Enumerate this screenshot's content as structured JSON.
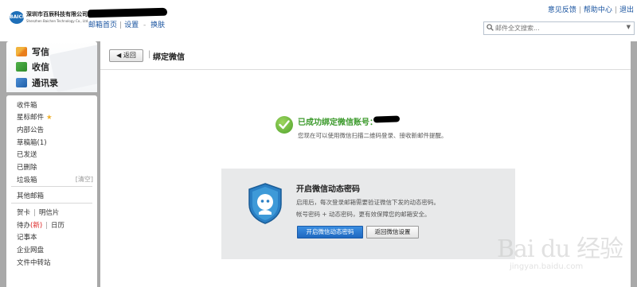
{
  "header": {
    "logo_mark": "BAICHEN",
    "company_cn": "深圳市百辰科技有限公司",
    "company_en": "Shenzhen Baichen Technology Co., Ltd.",
    "nav": [
      "邮箱首页",
      "设置",
      "换肤"
    ],
    "top_links": [
      "意见反馈",
      "帮助中心",
      "退出"
    ],
    "search_placeholder": "邮件全文搜索..."
  },
  "sidebar": {
    "actions": [
      {
        "label": "写信",
        "icon": "pencil-icon"
      },
      {
        "label": "收信",
        "icon": "inbox-icon"
      },
      {
        "label": "通讯录",
        "icon": "contacts-icon"
      }
    ],
    "folders": {
      "inbox": "收件箱",
      "starred": "星标邮件",
      "star_glyph": "★",
      "announcements": "内部公告",
      "drafts": "草稿箱(1)",
      "sent": "已发送",
      "deleted": "已删除",
      "spam": "垃圾箱",
      "clear": "[清空]",
      "other": "其他邮箱",
      "greeting_card": "贺卡",
      "postcard": "明信片",
      "todo": "待办",
      "todo_new": "(新)",
      "calendar": "日历",
      "notepad": "记事本",
      "netdisk": "企业网盘",
      "transfer": "文件中转站"
    },
    "separator": "|"
  },
  "main": {
    "back_label": "返回",
    "title_sep": "|",
    "title": "绑定微信",
    "success_title": "已成功绑定微信账号：",
    "success_desc": "您现在可以使用微信扫描二维码登录、接收新邮件提醒。",
    "promo": {
      "title": "开启微信动态密码",
      "desc1": "启用后，每次登录邮箱需要验证微信下发的动态密码。",
      "desc2": "帐号密码 + 动态密码，更有效保障您的邮箱安全。",
      "enable_button": "开启微信动态密码",
      "settings_button": "返回微信设置"
    }
  },
  "watermark": {
    "main": "Bai du 经验",
    "url": "jingyan.baidu.com"
  },
  "colors": {
    "link": "#1a54a0",
    "success": "#3c9a2c",
    "primary_button": "#1f68c0",
    "frame": "#a9a9a9"
  }
}
